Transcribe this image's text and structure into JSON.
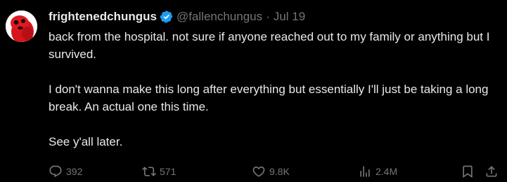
{
  "tweet": {
    "display_name": "frightenedchungus",
    "handle": "@fallenchungus",
    "separator": "·",
    "date": "Jul 19",
    "paragraphs": [
      "back from the hospital. not sure if anyone reached out to my family or anything but I survived.",
      "I don't wanna make this long after everything but essentially I'll just be taking a long break. An actual one this time.",
      "See y'all later."
    ]
  },
  "actions": {
    "reply_count": "392",
    "retweet_count": "571",
    "like_count": "9.8K",
    "view_count": "2.4M"
  },
  "icons": {
    "verified": "verified-badge-icon",
    "reply": "reply-icon",
    "retweet": "retweet-icon",
    "like": "heart-icon",
    "views": "views-icon",
    "bookmark": "bookmark-icon",
    "share": "share-icon"
  },
  "colors": {
    "background": "#000000",
    "text_primary": "#e7e9ea",
    "text_secondary": "#71767b",
    "verified_blue": "#1d9bf0"
  }
}
